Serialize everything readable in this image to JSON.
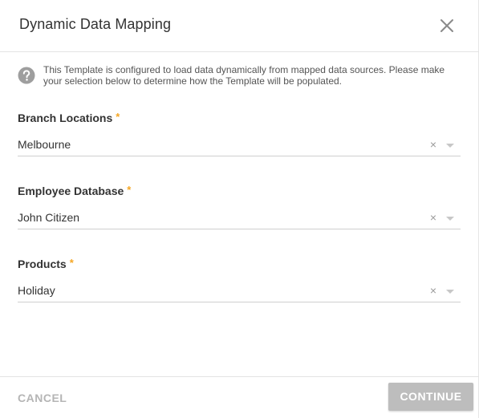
{
  "dialog": {
    "title": "Dynamic Data Mapping",
    "close_icon": "close-icon"
  },
  "info": {
    "icon": "help-circle-icon",
    "text": "This Template is configured to load data dynamically from mapped data sources. Please make your selection below to determine how the Template will be populated."
  },
  "fields": [
    {
      "label": "Branch Locations",
      "required_mark": "*",
      "value": "Melbourne",
      "clear_glyph": "×"
    },
    {
      "label": "Employee Database",
      "required_mark": "*",
      "value": "John Citizen",
      "clear_glyph": "×"
    },
    {
      "label": "Products",
      "required_mark": "*",
      "value": "Holiday",
      "clear_glyph": "×"
    }
  ],
  "footer": {
    "cancel_label": "CANCEL",
    "continue_label": "CONTINUE"
  },
  "colors": {
    "required": "#f5a623",
    "continue_bg": "#bdbdbd",
    "cancel_text": "#b5b5b5"
  }
}
